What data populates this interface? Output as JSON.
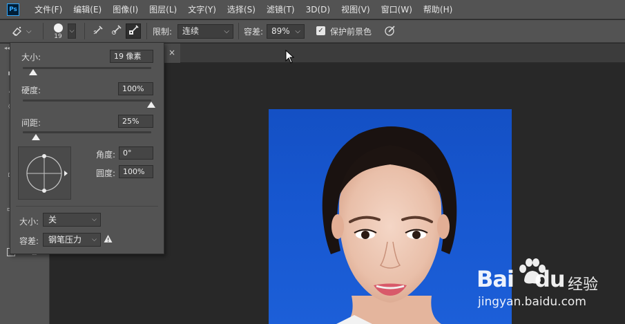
{
  "menubar": {
    "logo": "Ps",
    "items": [
      {
        "label": "文件(F)",
        "key": "file"
      },
      {
        "label": "编辑(E)",
        "key": "edit"
      },
      {
        "label": "图像(I)",
        "key": "image"
      },
      {
        "label": "图层(L)",
        "key": "layer"
      },
      {
        "label": "文字(Y)",
        "key": "type"
      },
      {
        "label": "选择(S)",
        "key": "select"
      },
      {
        "label": "滤镜(T)",
        "key": "filter"
      },
      {
        "label": "3D(D)",
        "key": "3d"
      },
      {
        "label": "视图(V)",
        "key": "view"
      },
      {
        "label": "窗口(W)",
        "key": "window"
      },
      {
        "label": "帮助(H)",
        "key": "help"
      }
    ]
  },
  "options": {
    "tool_preset_icon": "background-eraser-icon",
    "brush_size": "19",
    "sampling_modes": [
      "sampling-continuous-icon",
      "sampling-once-icon",
      "sampling-background-swatch-icon"
    ],
    "limits_label": "限制:",
    "limits_value": "连续",
    "tolerance_label": "容差:",
    "tolerance_value": "89%",
    "protect_fg_label": "保护前景色",
    "protect_fg_checked": true,
    "pressure_icon": "tablet-pressure-icon"
  },
  "brush_panel": {
    "size_label": "大小:",
    "size_value": "19 像素",
    "size_slider": 0.08,
    "hardness_label": "硬度:",
    "hardness_value": "100%",
    "hardness_slider": 1.0,
    "spacing_label": "间距:",
    "spacing_value": "25%",
    "spacing_slider": 0.1,
    "angle_label": "角度:",
    "angle_value": "0°",
    "roundness_label": "圆度:",
    "roundness_value": "100%",
    "size_control_label": "大小:",
    "size_control_value": "关",
    "tolerance_control_label": "容差:",
    "tolerance_control_value": "钢笔压力"
  },
  "document": {
    "tab_close": "×"
  },
  "watermark": {
    "logo": "Bai",
    "logo_suffix": "du",
    "cn": "经验",
    "url": "jingyan.baidu.com"
  },
  "colors": {
    "photo_background": "#1757d0",
    "ui_panel": "#535353",
    "canvas": "#282828"
  }
}
